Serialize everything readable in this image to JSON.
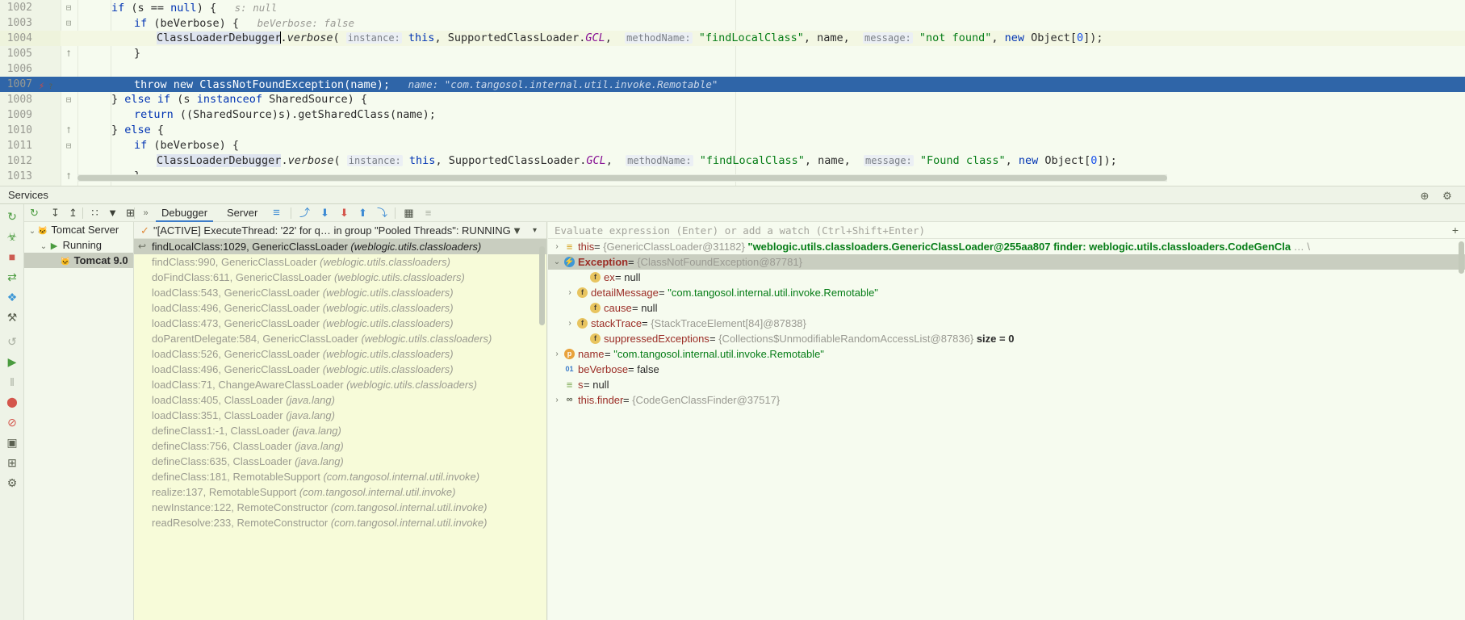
{
  "editor": {
    "lines": [
      {
        "num": "1002",
        "state": "normal",
        "indent": 28,
        "segments": [
          {
            "t": "if",
            "c": "kw"
          },
          {
            "t": " (s == ",
            "c": "plain"
          },
          {
            "t": "null",
            "c": "kw"
          },
          {
            "t": ") {",
            "c": "plain"
          },
          {
            "t": "   s: null",
            "c": "hint"
          }
        ]
      },
      {
        "num": "1003",
        "state": "normal",
        "indent": 56,
        "segments": [
          {
            "t": "if",
            "c": "kw"
          },
          {
            "t": " (beVerbose) {",
            "c": "plain"
          },
          {
            "t": "   beVerbose: false",
            "c": "hint"
          }
        ]
      },
      {
        "num": "1004",
        "state": "highlight",
        "indent": 84,
        "segments": [
          {
            "t": "ClassLoaderDebugger",
            "c": "idhl"
          },
          {
            "t": ".",
            "c": "plain"
          },
          {
            "t": "verbose",
            "c": "mth"
          },
          {
            "t": "( ",
            "c": "plain"
          },
          {
            "t": "instance:",
            "c": "chip"
          },
          {
            "t": " ",
            "c": "plain"
          },
          {
            "t": "this",
            "c": "kw"
          },
          {
            "t": ", SupportedClassLoader.",
            "c": "plain"
          },
          {
            "t": "GCL",
            "c": "fld"
          },
          {
            "t": ",  ",
            "c": "plain"
          },
          {
            "t": "methodName:",
            "c": "chip"
          },
          {
            "t": " ",
            "c": "plain"
          },
          {
            "t": "\"findLocalClass\"",
            "c": "str"
          },
          {
            "t": ", name,  ",
            "c": "plain"
          },
          {
            "t": "message:",
            "c": "chip"
          },
          {
            "t": " ",
            "c": "plain"
          },
          {
            "t": "\"not found\"",
            "c": "str"
          },
          {
            "t": ", ",
            "c": "plain"
          },
          {
            "t": "new",
            "c": "kw"
          },
          {
            "t": " Object[",
            "c": "plain"
          },
          {
            "t": "0",
            "c": "num"
          },
          {
            "t": "]);",
            "c": "plain"
          }
        ]
      },
      {
        "num": "1005",
        "state": "normal",
        "indent": 56,
        "segments": [
          {
            "t": "}",
            "c": "plain"
          }
        ]
      },
      {
        "num": "1006",
        "state": "normal",
        "indent": 0,
        "segments": []
      },
      {
        "num": "1007",
        "state": "selected",
        "indent": 56,
        "breakpoint": "exception-breakpoint-icon",
        "segments": [
          {
            "t": "throw",
            "c": "kw"
          },
          {
            "t": " ",
            "c": "plain"
          },
          {
            "t": "new",
            "c": "kw"
          },
          {
            "t": " ClassNotFoundException(name);",
            "c": "plain"
          },
          {
            "t": "   name: \"com.tangosol.internal.util.invoke.Remotable\"",
            "c": "hint"
          }
        ]
      },
      {
        "num": "1008",
        "state": "normal",
        "indent": 28,
        "segments": [
          {
            "t": "} ",
            "c": "plain"
          },
          {
            "t": "else if",
            "c": "kw"
          },
          {
            "t": " (s ",
            "c": "plain"
          },
          {
            "t": "instanceof",
            "c": "kw"
          },
          {
            "t": " SharedSource) {",
            "c": "plain"
          }
        ]
      },
      {
        "num": "1009",
        "state": "normal",
        "indent": 56,
        "segments": [
          {
            "t": "return",
            "c": "kw"
          },
          {
            "t": " ((SharedSource)s).getSharedClass(name);",
            "c": "plain"
          }
        ]
      },
      {
        "num": "1010",
        "state": "normal",
        "indent": 28,
        "segments": [
          {
            "t": "} ",
            "c": "plain"
          },
          {
            "t": "else",
            "c": "kw"
          },
          {
            "t": " {",
            "c": "plain"
          }
        ]
      },
      {
        "num": "1011",
        "state": "normal",
        "indent": 56,
        "segments": [
          {
            "t": "if",
            "c": "kw"
          },
          {
            "t": " (beVerbose) {",
            "c": "plain"
          }
        ]
      },
      {
        "num": "1012",
        "state": "normal",
        "indent": 84,
        "segments": [
          {
            "t": "ClassLoaderDebugger",
            "c": "idhl"
          },
          {
            "t": ".",
            "c": "plain"
          },
          {
            "t": "verbose",
            "c": "mth"
          },
          {
            "t": "( ",
            "c": "plain"
          },
          {
            "t": "instance:",
            "c": "chip"
          },
          {
            "t": " ",
            "c": "plain"
          },
          {
            "t": "this",
            "c": "kw"
          },
          {
            "t": ", SupportedClassLoader.",
            "c": "plain"
          },
          {
            "t": "GCL",
            "c": "fld"
          },
          {
            "t": ",  ",
            "c": "plain"
          },
          {
            "t": "methodName:",
            "c": "chip"
          },
          {
            "t": " ",
            "c": "plain"
          },
          {
            "t": "\"findLocalClass\"",
            "c": "str"
          },
          {
            "t": ", name,  ",
            "c": "plain"
          },
          {
            "t": "message:",
            "c": "chip"
          },
          {
            "t": " ",
            "c": "plain"
          },
          {
            "t": "\"Found class\"",
            "c": "str"
          },
          {
            "t": ", ",
            "c": "plain"
          },
          {
            "t": "new",
            "c": "kw"
          },
          {
            "t": " Object[",
            "c": "plain"
          },
          {
            "t": "0",
            "c": "num"
          },
          {
            "t": "]);",
            "c": "plain"
          }
        ]
      },
      {
        "num": "1013",
        "state": "normal",
        "indent": 56,
        "segments": [
          {
            "t": "}",
            "c": "plain"
          }
        ]
      }
    ]
  },
  "services": {
    "title": "Services",
    "header_icons": [
      {
        "name": "target-icon",
        "glyph": "⊕"
      },
      {
        "name": "settings-gear-icon",
        "glyph": "⚙"
      }
    ],
    "toolbar_icons": [
      {
        "name": "rerun-icon",
        "glyph": "↻"
      },
      {
        "name": "debug-icon",
        "glyph": "☣"
      },
      {
        "name": "stop-icon",
        "glyph": "■"
      },
      {
        "name": "attach-icon",
        "glyph": "⇄"
      },
      {
        "name": "deploy-icon",
        "glyph": "❖"
      },
      {
        "name": "settings-wrench-icon",
        "glyph": "⚒"
      },
      {
        "name": "restart-icon",
        "glyph": "↺"
      },
      {
        "name": "resume-program-icon",
        "glyph": "▶"
      },
      {
        "name": "pause-program-icon",
        "glyph": "‖"
      },
      {
        "name": "view-breakpoints-icon",
        "glyph": "⬤"
      },
      {
        "name": "mute-breakpoints-icon",
        "glyph": "⊘"
      },
      {
        "name": "camera-icon",
        "glyph": "▣"
      },
      {
        "name": "layout-icon",
        "glyph": "⊞"
      },
      {
        "name": "settings-cog-icon",
        "glyph": "⚙"
      }
    ],
    "tree_toolbar": [
      {
        "name": "expand-all-icon",
        "glyph": "↧"
      },
      {
        "name": "collapse-all-icon",
        "glyph": "↥"
      },
      {
        "name": "group-icon",
        "glyph": "∷"
      },
      {
        "name": "filter-icon",
        "glyph": "▼"
      },
      {
        "name": "add-icon",
        "glyph": "⊞"
      },
      {
        "name": "more-icon",
        "glyph": "»"
      }
    ],
    "tree": [
      {
        "label": "Tomcat Server",
        "depth": 0,
        "twisty": "⌄",
        "icon": "tomcat-icon",
        "selected": false,
        "bold": false
      },
      {
        "label": "Running",
        "depth": 1,
        "twisty": "⌄",
        "icon": "run-icon",
        "selected": false,
        "bold": false
      },
      {
        "label": "Tomcat 9.0",
        "depth": 2,
        "twisty": "",
        "icon": "tomcat-icon",
        "selected": true,
        "bold": true
      }
    ]
  },
  "debugger": {
    "tabs": [
      {
        "label": "Debugger",
        "active": true
      },
      {
        "label": "Server",
        "active": false
      }
    ],
    "more_button": "»",
    "toolbar_icons": [
      {
        "name": "console-icon",
        "glyph": "≡"
      },
      {
        "name": "step-over-icon",
        "glyph": "⤴"
      },
      {
        "name": "step-into-icon",
        "glyph": "⬇"
      },
      {
        "name": "force-step-into-icon",
        "glyph": "⬇"
      },
      {
        "name": "step-out-icon",
        "glyph": "⬆"
      },
      {
        "name": "run-to-cursor-icon",
        "glyph": "⤵"
      },
      {
        "name": "evaluate-expression-icon",
        "glyph": "▦"
      },
      {
        "name": "settings-lines-icon",
        "glyph": "≡"
      }
    ],
    "thread": {
      "label": "\"[ACTIVE] ExecuteThread: '22' for q… in group \"Pooled Threads\": RUNNING",
      "check_icon": "✓",
      "filter_icon": "▼",
      "dropdown_icon": "▾"
    },
    "frames": [
      {
        "method": "findLocalClass:1029, GenericClassLoader",
        "pkg": "(weblogic.utils.classloaders)",
        "current": true
      },
      {
        "method": "findClass:990, GenericClassLoader",
        "pkg": "(weblogic.utils.classloaders)",
        "current": false
      },
      {
        "method": "doFindClass:611, GenericClassLoader",
        "pkg": "(weblogic.utils.classloaders)",
        "current": false
      },
      {
        "method": "loadClass:543, GenericClassLoader",
        "pkg": "(weblogic.utils.classloaders)",
        "current": false
      },
      {
        "method": "loadClass:496, GenericClassLoader",
        "pkg": "(weblogic.utils.classloaders)",
        "current": false
      },
      {
        "method": "loadClass:473, GenericClassLoader",
        "pkg": "(weblogic.utils.classloaders)",
        "current": false
      },
      {
        "method": "doParentDelegate:584, GenericClassLoader",
        "pkg": "(weblogic.utils.classloaders)",
        "current": false
      },
      {
        "method": "loadClass:526, GenericClassLoader",
        "pkg": "(weblogic.utils.classloaders)",
        "current": false
      },
      {
        "method": "loadClass:496, GenericClassLoader",
        "pkg": "(weblogic.utils.classloaders)",
        "current": false
      },
      {
        "method": "loadClass:71, ChangeAwareClassLoader",
        "pkg": "(weblogic.utils.classloaders)",
        "current": false
      },
      {
        "method": "loadClass:405, ClassLoader",
        "pkg": "(java.lang)",
        "current": false
      },
      {
        "method": "loadClass:351, ClassLoader",
        "pkg": "(java.lang)",
        "current": false
      },
      {
        "method": "defineClass1:-1, ClassLoader",
        "pkg": "(java.lang)",
        "current": false
      },
      {
        "method": "defineClass:756, ClassLoader",
        "pkg": "(java.lang)",
        "current": false
      },
      {
        "method": "defineClass:635, ClassLoader",
        "pkg": "(java.lang)",
        "current": false
      },
      {
        "method": "defineClass:181, RemotableSupport",
        "pkg": "(com.tangosol.internal.util.invoke)",
        "current": false
      },
      {
        "method": "realize:137, RemotableSupport",
        "pkg": "(com.tangosol.internal.util.invoke)",
        "current": false
      },
      {
        "method": "newInstance:122, RemoteConstructor",
        "pkg": "(com.tangosol.internal.util.invoke)",
        "current": false
      },
      {
        "method": "readResolve:233, RemoteConstructor",
        "pkg": "(com.tangosol.internal.util.invoke)",
        "current": false
      }
    ]
  },
  "variables": {
    "evaluate_placeholder": "Evaluate expression (Enter) or add a watch (Ctrl+Shift+Enter)",
    "add_watch_icon": "+",
    "rows": [
      {
        "depth": 0,
        "twisty": "›",
        "icon": "object-node-icon",
        "icon_kind": "obj",
        "name": "this",
        "selected": false,
        "value_parts": [
          {
            "t": " = ",
            "c": "eq"
          },
          {
            "t": "{GenericClassLoader@31182} ",
            "c": "obj"
          },
          {
            "t": "\"weblogic.utils.classloaders.GenericClassLoader@255aa807 finder: weblogic.utils.classloaders.CodeGenCla",
            "c": "strbold"
          },
          {
            "t": " … \\",
            "c": "dots"
          }
        ]
      },
      {
        "depth": 0,
        "twisty": "⌄",
        "icon": "exception-node-icon",
        "icon_kind": "exc",
        "name": "Exception",
        "selected": true,
        "name_bold": true,
        "value_parts": [
          {
            "t": " = ",
            "c": "eq"
          },
          {
            "t": "{ClassNotFoundException@87781}",
            "c": "obj"
          }
        ]
      },
      {
        "depth": 2,
        "twisty": "",
        "icon": "field-icon",
        "icon_kind": "f",
        "name": "ex",
        "selected": false,
        "value_parts": [
          {
            "t": " = ",
            "c": "eq"
          },
          {
            "t": "null",
            "c": "kw"
          }
        ]
      },
      {
        "depth": 1,
        "twisty": "›",
        "icon": "field-icon",
        "icon_kind": "f",
        "name": "detailMessage",
        "selected": false,
        "value_parts": [
          {
            "t": " = ",
            "c": "eq"
          },
          {
            "t": "\"com.tangosol.internal.util.invoke.Remotable\"",
            "c": "str"
          }
        ]
      },
      {
        "depth": 2,
        "twisty": "",
        "icon": "field-icon",
        "icon_kind": "f",
        "name": "cause",
        "selected": false,
        "value_parts": [
          {
            "t": " = ",
            "c": "eq"
          },
          {
            "t": "null",
            "c": "kw"
          }
        ]
      },
      {
        "depth": 1,
        "twisty": "›",
        "icon": "field-icon",
        "icon_kind": "f",
        "name": "stackTrace",
        "selected": false,
        "value_parts": [
          {
            "t": " = ",
            "c": "eq"
          },
          {
            "t": "{StackTraceElement[84]@87838}",
            "c": "obj"
          }
        ]
      },
      {
        "depth": 2,
        "twisty": "",
        "icon": "field-icon",
        "icon_kind": "f",
        "name": "suppressedExceptions",
        "selected": false,
        "value_parts": [
          {
            "t": " = ",
            "c": "eq"
          },
          {
            "t": "{Collections$UnmodifiableRandomAccessList@87836} ",
            "c": "obj"
          },
          {
            "t": "size = 0",
            "c": "extra"
          }
        ]
      },
      {
        "depth": 0,
        "twisty": "›",
        "icon": "parameter-icon",
        "icon_kind": "p",
        "name": "name",
        "selected": false,
        "value_parts": [
          {
            "t": " = ",
            "c": "eq"
          },
          {
            "t": "\"com.tangosol.internal.util.invoke.Remotable\"",
            "c": "str"
          }
        ]
      },
      {
        "depth": 0,
        "twisty": "",
        "icon": "boolean-icon",
        "icon_kind": "bin",
        "name": "beVerbose",
        "selected": false,
        "value_parts": [
          {
            "t": " = ",
            "c": "eq"
          },
          {
            "t": "false",
            "c": "kw"
          }
        ]
      },
      {
        "depth": 0,
        "twisty": "",
        "icon": "local-variable-icon",
        "icon_kind": "sq",
        "name": "s",
        "selected": false,
        "value_parts": [
          {
            "t": " = ",
            "c": "eq"
          },
          {
            "t": "null",
            "c": "kw"
          }
        ]
      },
      {
        "depth": 0,
        "twisty": "›",
        "icon": "reference-icon",
        "icon_kind": "lnk",
        "name": "this.finder",
        "selected": false,
        "value_parts": [
          {
            "t": " = ",
            "c": "eq"
          },
          {
            "t": "{CodeGenClassFinder@37517}",
            "c": "obj"
          }
        ]
      }
    ]
  }
}
